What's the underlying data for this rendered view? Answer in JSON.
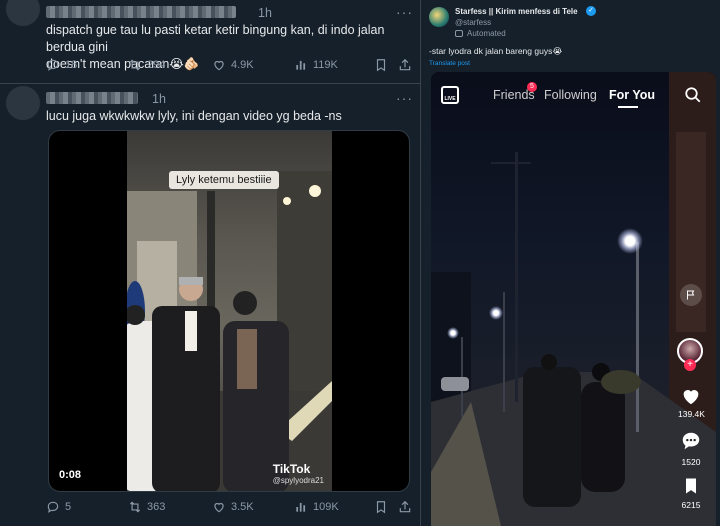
{
  "tweet1": {
    "time": "1h",
    "text_line1": "dispatch gue tau lu pasti ketar ketir bingung kan, di indo jalan berdua gini",
    "text_line2": "doesn't mean pacaran😭🫵🏻",
    "replies": "18",
    "retweets": "294",
    "likes": "4.9K",
    "views": "119K"
  },
  "tweet2": {
    "time": "1h",
    "text": "lucu juga wkwkwkw lyly, ini dengan video yg beda -ns",
    "video_caption": "Lyly ketemu bestiiie",
    "video_time": "0:08",
    "watermark_brand": "TikTok",
    "watermark_handle": "@spylyodra21",
    "replies": "5",
    "retweets": "363",
    "likes": "3.5K",
    "views": "109K"
  },
  "right_tweet": {
    "author": "Starfess || Kirim menfess di Tele",
    "handle": "@starfess",
    "automated_label": "Automated",
    "text": "-star lyodra dk jalan bareng guys😭",
    "translate": "Translate post",
    "tiktok": {
      "live_label": "LIVE",
      "tabs": [
        "Friends",
        "Following",
        "For You"
      ],
      "friends_badge": "5",
      "likes": "139.4K",
      "comments": "1520",
      "bookmarks": "6215"
    }
  },
  "colors": {
    "background": "#15202b",
    "muted": "#8b98a5",
    "accent": "#1d9bf0",
    "tiktok_red": "#fe2c55"
  }
}
